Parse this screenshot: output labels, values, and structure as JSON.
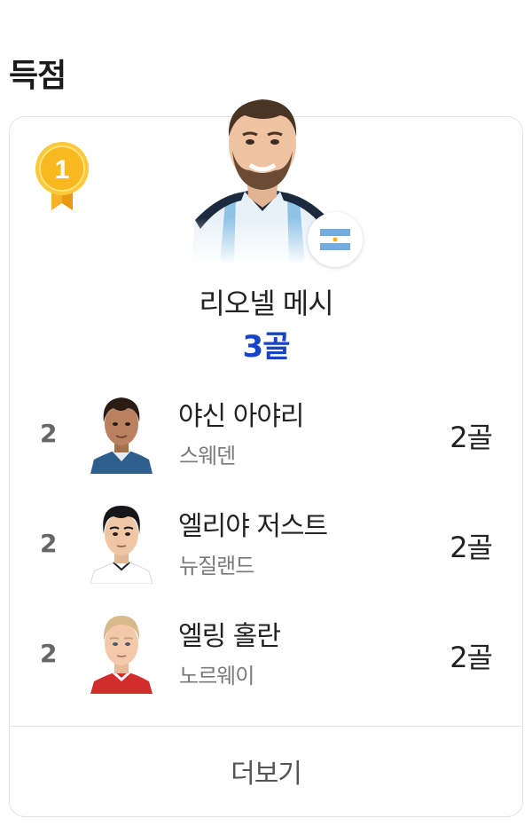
{
  "section": {
    "title": "득점"
  },
  "leader": {
    "rank": "1",
    "name": "리오넬 메시",
    "goals": "3골",
    "country_flag": "argentina-flag-icon"
  },
  "players": [
    {
      "rank": "2",
      "name": "야신 아야리",
      "team": "스웨덴",
      "goals": "2골"
    },
    {
      "rank": "2",
      "name": "엘리야 저스트",
      "team": "뉴질랜드",
      "goals": "2골"
    },
    {
      "rank": "2",
      "name": "엘링 홀란",
      "team": "노르웨이",
      "goals": "2골"
    }
  ],
  "more_label": "더보기",
  "colors": {
    "accent_blue": "#1743c7",
    "medal_gold": "#f5b400",
    "card_border": "#e3e3e6"
  }
}
